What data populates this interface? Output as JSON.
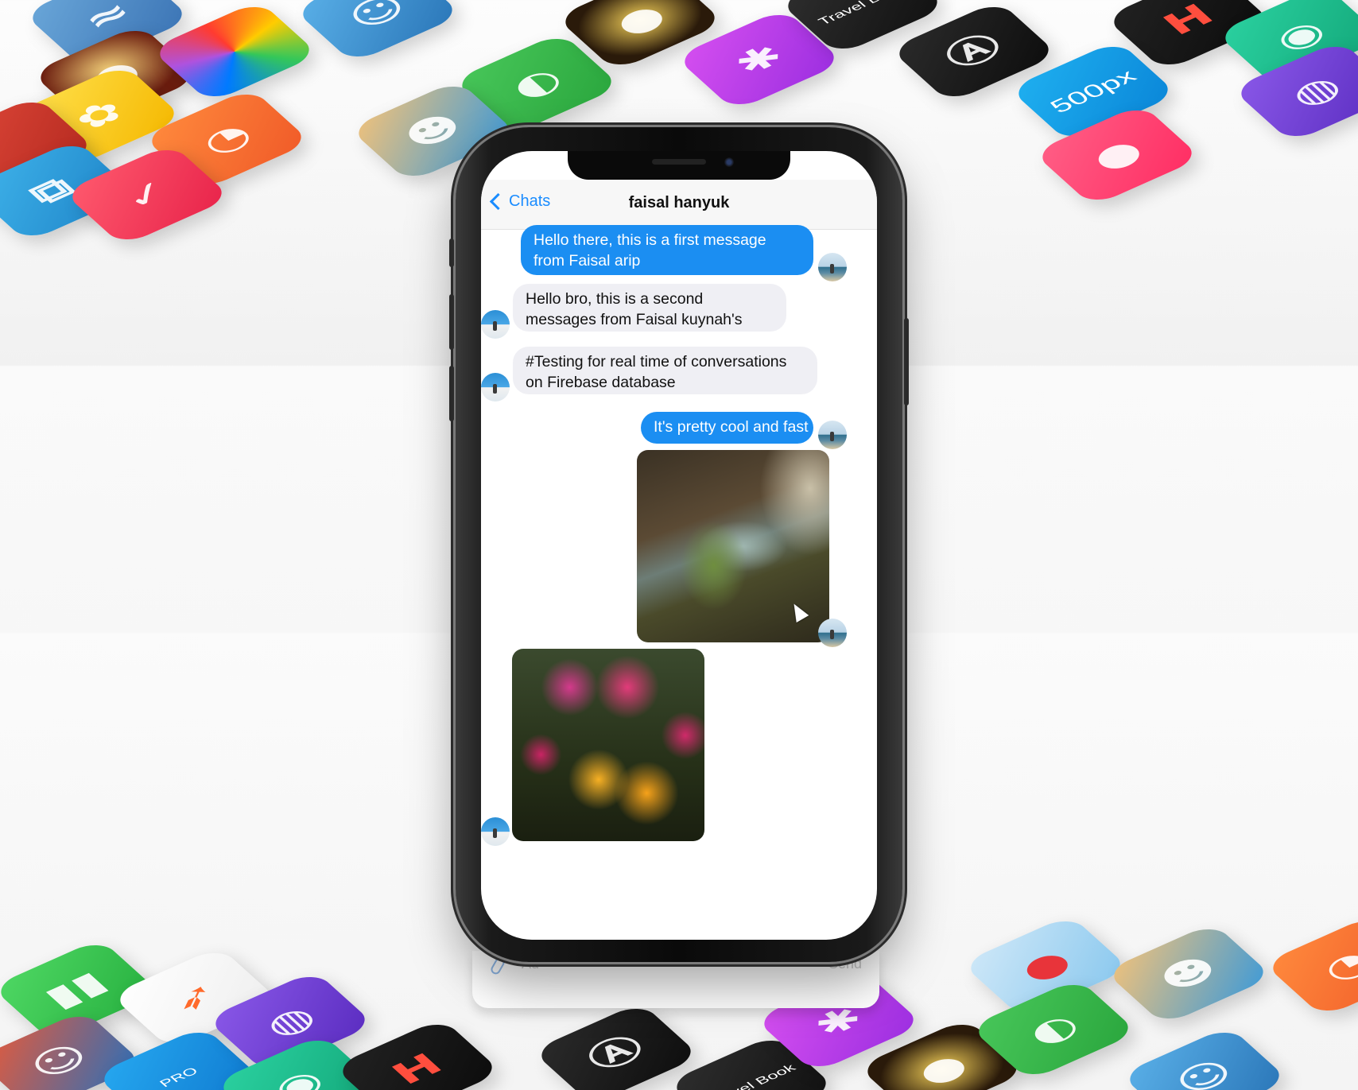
{
  "nav": {
    "back_label": "Chats",
    "title": "faisal hanyuk"
  },
  "messages": [
    {
      "direction": "outgoing",
      "type": "text",
      "text": "Hello there, this is a first message from Faisal arip"
    },
    {
      "direction": "incoming",
      "type": "text",
      "text": "Hello bro, this is a second messages from Faisal kuynah's"
    },
    {
      "direction": "incoming",
      "type": "text",
      "text": "#Testing for real time of conversations on Firebase database"
    },
    {
      "direction": "outgoing",
      "type": "text",
      "text": "It's pretty cool and fast"
    },
    {
      "direction": "outgoing",
      "type": "image",
      "image": "waterfall-photo"
    },
    {
      "direction": "incoming",
      "type": "image",
      "image": "flowers-photo"
    }
  ],
  "input_bar": {
    "placeholder": "Ad",
    "send_label": "Send"
  },
  "colors": {
    "outgoing_bubble": "#1b8ef2",
    "incoming_bubble": "#efeff4",
    "link_blue": "#1a8cff"
  },
  "background_icons": {
    "brand_500px": "500px",
    "brand_travel_book": "Travel Book",
    "brand_pro": "PRO"
  }
}
